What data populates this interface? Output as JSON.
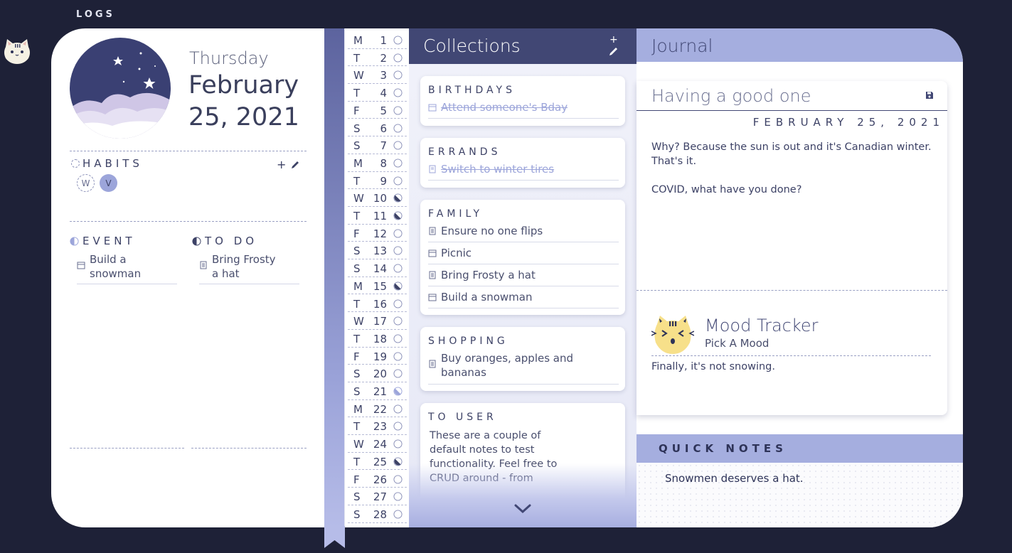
{
  "header": {
    "logs_label": "LOGS"
  },
  "date": {
    "weekday": "Thursday",
    "full": "February 25, 2021"
  },
  "habits": {
    "title": "HABITS",
    "add_symbol": "+",
    "items": [
      {
        "label": "W"
      },
      {
        "label": "V"
      }
    ]
  },
  "event": {
    "title": "EVENT",
    "item": "Build a snowman"
  },
  "todo": {
    "title": "TO DO",
    "item": "Bring Frosty a hat"
  },
  "month_days": [
    {
      "letter": "M",
      "num": "1",
      "mood": "empty"
    },
    {
      "letter": "T",
      "num": "2",
      "mood": "empty"
    },
    {
      "letter": "W",
      "num": "3",
      "mood": "empty"
    },
    {
      "letter": "T",
      "num": "4",
      "mood": "empty"
    },
    {
      "letter": "F",
      "num": "5",
      "mood": "empty"
    },
    {
      "letter": "S",
      "num": "6",
      "mood": "empty"
    },
    {
      "letter": "S",
      "num": "7",
      "mood": "empty"
    },
    {
      "letter": "M",
      "num": "8",
      "mood": "empty"
    },
    {
      "letter": "T",
      "num": "9",
      "mood": "empty"
    },
    {
      "letter": "W",
      "num": "10",
      "mood": "dark-half"
    },
    {
      "letter": "T",
      "num": "11",
      "mood": "dark-half"
    },
    {
      "letter": "F",
      "num": "12",
      "mood": "empty"
    },
    {
      "letter": "S",
      "num": "13",
      "mood": "empty"
    },
    {
      "letter": "S",
      "num": "14",
      "mood": "empty"
    },
    {
      "letter": "M",
      "num": "15",
      "mood": "dark-half"
    },
    {
      "letter": "T",
      "num": "16",
      "mood": "empty"
    },
    {
      "letter": "W",
      "num": "17",
      "mood": "empty"
    },
    {
      "letter": "T",
      "num": "18",
      "mood": "empty"
    },
    {
      "letter": "F",
      "num": "19",
      "mood": "empty"
    },
    {
      "letter": "S",
      "num": "20",
      "mood": "empty"
    },
    {
      "letter": "S",
      "num": "21",
      "mood": "light-half"
    },
    {
      "letter": "M",
      "num": "22",
      "mood": "empty"
    },
    {
      "letter": "T",
      "num": "23",
      "mood": "empty"
    },
    {
      "letter": "W",
      "num": "24",
      "mood": "empty"
    },
    {
      "letter": "T",
      "num": "25",
      "mood": "dark-half"
    },
    {
      "letter": "F",
      "num": "26",
      "mood": "empty"
    },
    {
      "letter": "S",
      "num": "27",
      "mood": "empty"
    },
    {
      "letter": "S",
      "num": "28",
      "mood": "empty"
    }
  ],
  "collections": {
    "title": "Collections",
    "add_symbol": "+",
    "birthdays": {
      "title": "BIRTHDAYS",
      "items": [
        "Attend someone's Bday"
      ]
    },
    "errands": {
      "title": "ERRANDS",
      "items": [
        "Switch to winter tires"
      ]
    },
    "family": {
      "title": "FAMILY",
      "items": [
        "Ensure no one flips",
        "Picnic",
        "Bring Frosty a hat",
        "Build a snowman"
      ]
    },
    "shopping": {
      "title": "SHOPPING",
      "items": [
        "Buy oranges, apples and bananas"
      ]
    },
    "to_user": {
      "title": "TO USER",
      "text": "These are a couple of default notes to test functionality. Feel free to CRUD around - from"
    }
  },
  "journal": {
    "title": "Journal",
    "entry_title": "Having a good one",
    "entry_date": "FEBRUARY 25, 2021",
    "body_1": "Why? Because the sun is out and it's Canadian winter. That's it.",
    "body_2": "COVID, what have you done?",
    "mood_title": "Mood Tracker",
    "mood_sub": "Pick A Mood",
    "mood_note": "Finally, it's not snowing."
  },
  "quick_notes": {
    "title": "QUICK NOTES",
    "text": "Snowmen deserves a hat."
  },
  "colors": {
    "background": "#1e2137",
    "navy": "#414774",
    "periwinkle": "#a5aedf",
    "mood_yellow": "#f7e08a"
  }
}
